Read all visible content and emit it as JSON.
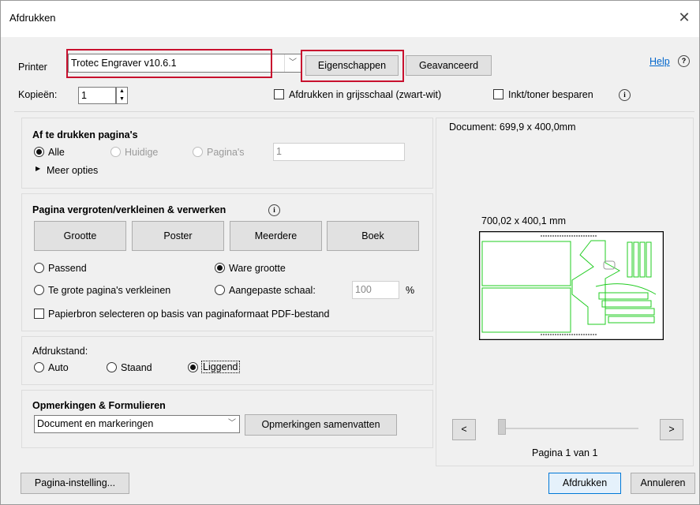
{
  "window": {
    "title": "Afdrukken",
    "close_icon": "close-icon"
  },
  "printer": {
    "label": "Printer",
    "value": "Trotec Engraver v10.6.1",
    "properties": "Eigenschappen",
    "advanced": "Geavanceerd",
    "help": "Help"
  },
  "copies": {
    "label": "Kopieën:",
    "value": "1"
  },
  "options": {
    "grayscale": "Afdrukken in grijsschaal (zwart-wit)",
    "ink_save": "Inkt/toner besparen"
  },
  "pages": {
    "heading": "Af te drukken pagina's",
    "all": "Alle",
    "current": "Huidige",
    "pages": "Pagina's",
    "pages_value": "1",
    "more": "Meer opties"
  },
  "sizing": {
    "heading": "Pagina vergroten/verkleinen & verwerken",
    "buttons": [
      "Grootte",
      "Poster",
      "Meerdere",
      "Boek"
    ],
    "fit": "Passend",
    "actual": "Ware grootte",
    "shrink": "Te grote pagina's verkleinen",
    "custom": "Aangepaste schaal:",
    "scale_value": "100",
    "percent": "%",
    "paper_source": "Papierbron selecteren op basis van paginaformaat PDF-bestand"
  },
  "orientation": {
    "heading": "Afdrukstand:",
    "auto": "Auto",
    "portrait": "Staand",
    "landscape": "Liggend"
  },
  "comments": {
    "heading": "Opmerkingen & Formulieren",
    "select_value": "Document en markeringen",
    "summarize": "Opmerkingen samenvatten"
  },
  "preview": {
    "document_size": "Document: 699,9 x 400,0mm",
    "page_size": "700,02 x 400,1 mm",
    "prev": "<",
    "next": ">",
    "page_indicator": "Pagina 1 van 1"
  },
  "footer": {
    "page_setup": "Pagina-instelling...",
    "print": "Afdrukken",
    "cancel": "Annuleren"
  },
  "colors": {
    "highlight": "#c8102e",
    "preview_green": "#22cc22",
    "link": "#0066cc"
  }
}
